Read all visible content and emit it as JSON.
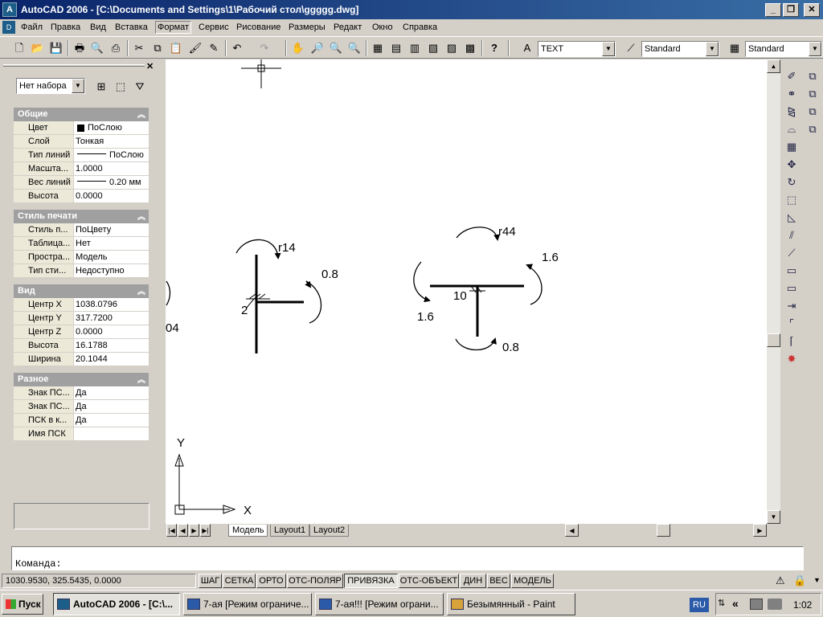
{
  "window": {
    "title": "AutoCAD 2006 - [C:\\Documents and Settings\\1\\Рабочий стол\\ggggg.dwg]",
    "min": "_",
    "restore": "❐",
    "close": "✕"
  },
  "menu": [
    "Файл",
    "Правка",
    "Вид",
    "Вставка",
    "Формат",
    "Сервис",
    "Рисование",
    "Размеры",
    "Редакт",
    "Окно",
    "Справка"
  ],
  "toolbar": {
    "text_style": "TEXT",
    "dim_style": "Standard",
    "table_style": "Standard"
  },
  "palette": {
    "selection": "Нет набора",
    "sections": [
      {
        "title": "Общие",
        "rows": [
          [
            "Цвет",
            "ПоСлою"
          ],
          [
            "Слой",
            "Тонкая"
          ],
          [
            "Тип линий",
            "ПоСлою"
          ],
          [
            "Масшта...",
            "1.0000"
          ],
          [
            "Вес линий",
            "0.20 мм"
          ],
          [
            "Высота",
            "0.0000"
          ]
        ]
      },
      {
        "title": "Стиль печати",
        "rows": [
          [
            "Стиль п...",
            "ПоЦвету"
          ],
          [
            "Таблица...",
            "Нет"
          ],
          [
            "Простра...",
            "Модель"
          ],
          [
            "Тип сти...",
            "Недоступно"
          ]
        ]
      },
      {
        "title": "Вид",
        "rows": [
          [
            "Центр X",
            "1038.0796"
          ],
          [
            "Центр Y",
            "317.7200"
          ],
          [
            "Центр Z",
            "0.0000"
          ],
          [
            "Высота",
            "16.1788"
          ],
          [
            "Ширина",
            "20.1044"
          ]
        ]
      },
      {
        "title": "Разное",
        "rows": [
          [
            "Знак ПС...",
            "Да"
          ],
          [
            "Знак ПС...",
            "Да"
          ],
          [
            "ПСК в к...",
            "Да"
          ],
          [
            "Имя ПСК",
            ""
          ]
        ]
      }
    ]
  },
  "drawing": {
    "labels": {
      "left_r": "r14",
      "left_08": "0.8",
      "left_2": "2",
      "left_cut": "04",
      "right_r": "r44",
      "right_16a": "1.6",
      "right_16b": "1.6",
      "right_10": "10",
      "right_08": "0.8"
    },
    "ucs": {
      "x": "X",
      "y": "Y"
    }
  },
  "tabs": [
    "Модель",
    "Layout1",
    "Layout2"
  ],
  "command": {
    "prompt": "Команда:"
  },
  "status": {
    "coords": "1030.9530, 325.5435, 0.0000",
    "buttons": [
      "ШАГ",
      "СЕТКА",
      "ОРТО",
      "ОТС-ПОЛЯР",
      "ПРИВЯЗКА",
      "ОТС-ОБЪЕКТ",
      "ДИН",
      "ВЕС",
      "МОДЕЛЬ"
    ]
  },
  "taskbar": {
    "start": "Пуск",
    "tasks": [
      "AutoCAD 2006 - [C:\\...",
      "7-ая [Режим ограниче...",
      "7-ая!!! [Режим ограни...",
      "Безымянный - Paint"
    ],
    "lang": "RU",
    "clock": "1:02"
  }
}
